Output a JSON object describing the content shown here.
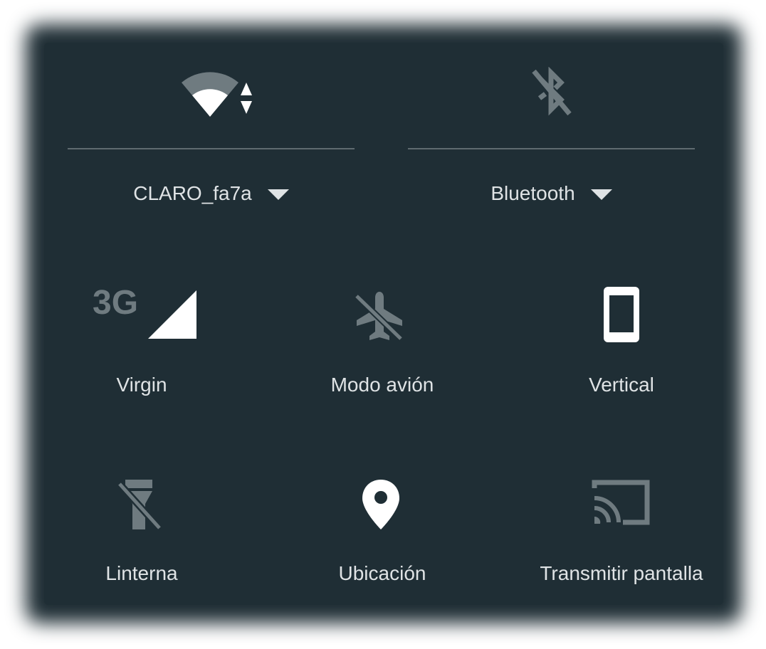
{
  "wifi": {
    "network_name": "CLARO_fa7a",
    "icon": "wifi-icon",
    "activity_icon": "data-activity-arrows-icon"
  },
  "bluetooth": {
    "label": "Bluetooth",
    "icon": "bluetooth-disabled-icon"
  },
  "tiles": [
    {
      "label": "Virgin",
      "icon": "cellular-signal-icon",
      "badge": "3G"
    },
    {
      "label": "Modo avión",
      "icon": "airplane-off-icon"
    },
    {
      "label": "Vertical",
      "icon": "portrait-rotation-icon"
    },
    {
      "label": "Linterna",
      "icon": "flashlight-off-icon"
    },
    {
      "label": "Ubicación",
      "icon": "location-pin-icon"
    },
    {
      "label": "Transmitir pantalla",
      "icon": "cast-icon"
    }
  ],
  "colors": {
    "panel_background": "#1f2e35",
    "text": "#dfe3e5",
    "icon_active": "#ffffff",
    "icon_inactive": "#6f7b80",
    "divider": "#5f6b70"
  }
}
